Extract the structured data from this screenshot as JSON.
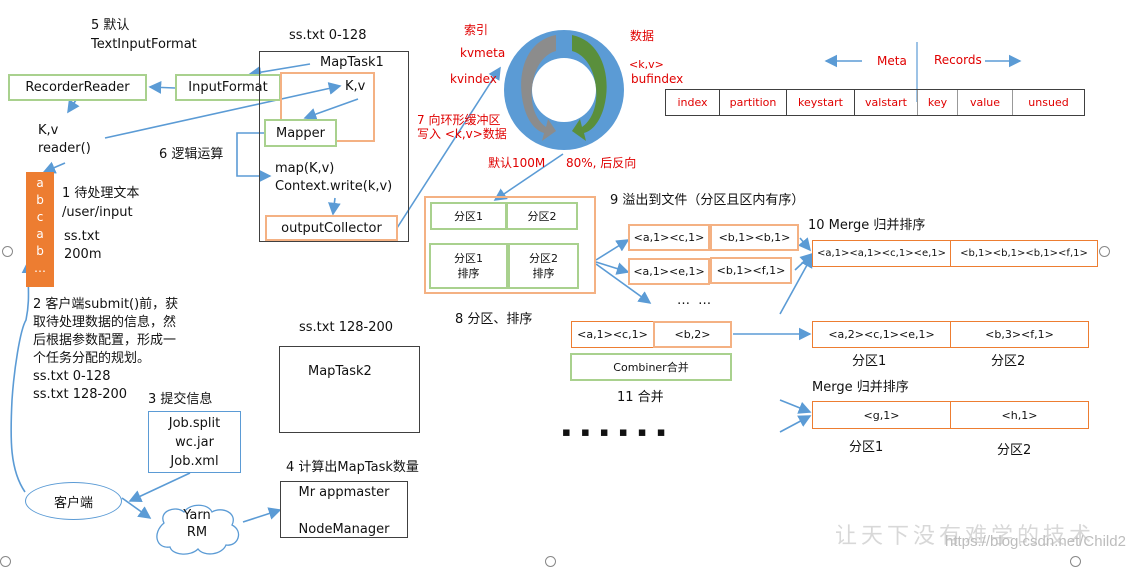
{
  "step5": {
    "title": "5 默认",
    "subtitle": "TextInputFormat"
  },
  "recorder_reader": "RecorderReader",
  "input_format": "InputFormat",
  "reader_label": {
    "kv": "K,v",
    "call": "reader()"
  },
  "step6": "6 逻辑运算",
  "maptask1": {
    "split": "ss.txt 0-128",
    "title": "MapTask1",
    "kv": "K,v",
    "mapper": "Mapper",
    "map_call": "map(K,v)",
    "context_write": "Context.write(k,v)",
    "output_collector": "outputCollector"
  },
  "file_block": {
    "letters": [
      "a",
      "b",
      "c",
      "a",
      "b",
      "…"
    ]
  },
  "step1": {
    "title": "1 待处理文本",
    "path": "/user/input",
    "file": "ss.txt",
    "size": "200m"
  },
  "step2": {
    "lines": [
      "2 客户端submit()前，获",
      "取待处理数据的信息，然",
      "后根据参数配置，形成一",
      "个任务分配的规划。",
      "ss.txt  0-128",
      "ss.txt  128-200"
    ]
  },
  "step3": {
    "title": "3 提交信息",
    "files": [
      "Job.split",
      "wc.jar",
      "Job.xml"
    ]
  },
  "client": "客户端",
  "yarn": {
    "line1": "Yarn",
    "line2": "RM"
  },
  "step4": "4 计算出MapTask数量",
  "appmaster": {
    "line1": "Mr appmaster",
    "line2": "NodeManager"
  },
  "maptask2": {
    "split": "ss.txt 128-200",
    "title": "MapTask2"
  },
  "ring_buffer": {
    "index_label": "索引",
    "kvmeta": "kvmeta",
    "kvindex": "kvindex",
    "data_label": "数据",
    "kv": "<k,v>",
    "bufindex": "bufindex",
    "step7_line1": "7 向环形缓冲区",
    "step7_line2": "写入 <k,v>数据",
    "default_size": "默认100M",
    "threshold": "80%, 后反向",
    "colors": {
      "ring": "#5b9bd5",
      "gray_arrow": "#8c8c8c",
      "green_arrow": "#5a8f3c"
    }
  },
  "buffer_layout": {
    "meta_label": "Meta",
    "records_label": "Records",
    "columns": [
      "index",
      "partition",
      "keystart",
      "valstart",
      "key",
      "value",
      "unsued"
    ]
  },
  "partition_box": {
    "p1": "分区1",
    "p2": "分区2",
    "p1_sort": [
      "分区1",
      "排序"
    ],
    "p2_sort": [
      "分区2",
      "排序"
    ]
  },
  "step8": "8 分区、排序",
  "step9": "9 溢出到文件（分区且区内有序）",
  "spill_files": [
    {
      "p1": "<a,1><c,1>",
      "p2": "<b,1><b,1>"
    },
    {
      "p1": "<a,1><e,1>",
      "p2": "<b,1><f,1>"
    }
  ],
  "ellipsis_small": "…   …",
  "step10": "10 Merge 归并排序",
  "merged": {
    "p1": "<a,1><a,1><c,1><e,1>",
    "p2": "<b,1><b,1><b,1><f,1>"
  },
  "combiner_input": {
    "p1": "<a,1><c,1>",
    "p2": "<b,2>"
  },
  "combiner": "Combiner合并",
  "step11": "11 合并",
  "combined": {
    "p1": "<a,2><c,1><e,1>",
    "p2": "<b,3><f,1>",
    "label1": "分区1",
    "label2": "分区2"
  },
  "merge2": {
    "title": "Merge 归并排序",
    "p1": "<g,1>",
    "p2": "<h,1>",
    "label1": "分区1",
    "label2": "分区2"
  },
  "big_ellipsis": "▪ ▪ ▪   ▪ ▪ ▪",
  "watermark": {
    "text": "让天下没有难学的技术",
    "url": "https://blog.csdn.net/Child2"
  }
}
